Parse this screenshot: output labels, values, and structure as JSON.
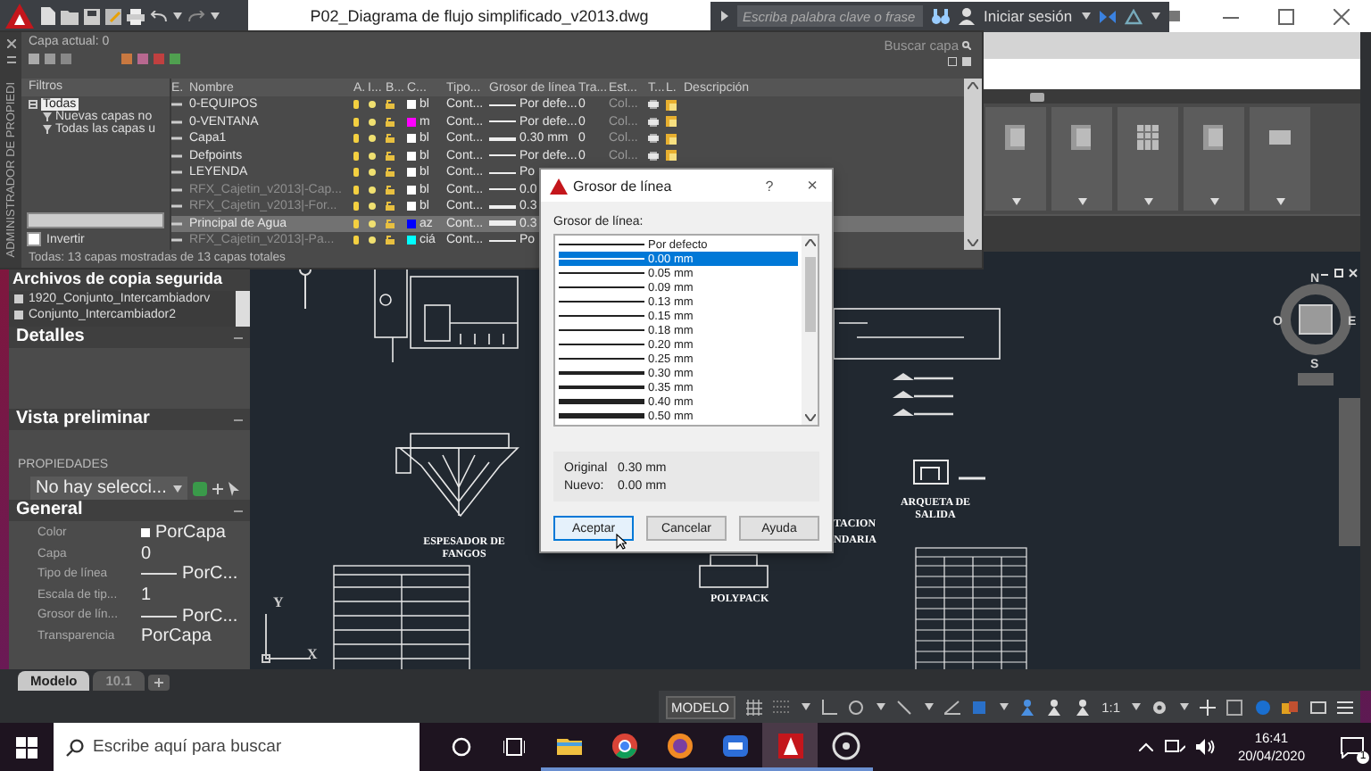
{
  "title_bar": {
    "title": "P02_Diagrama de flujo simplificado_v2013.dwg",
    "search": {
      "placeholder": "Escriba palabra clave o frase"
    },
    "sign_in": "Iniciar sesión"
  },
  "layer_manager": {
    "side_title": "ADMINISTRADOR DE PROPIEDI",
    "current_layer": "Capa actual: 0",
    "search": {
      "placeholder": "Buscar capa"
    },
    "filters_heading": "Filtros",
    "filters": [
      {
        "label": "Todas",
        "selected": true,
        "children": [
          {
            "label": "Nuevas capas no",
            "selected": false
          },
          {
            "label": "Todas las capas u",
            "selected": false
          }
        ]
      }
    ],
    "invert": {
      "label": "Invertir",
      "checked": false
    },
    "columns": [
      "E.",
      "Nombre",
      "A.",
      "I...",
      "B...",
      "C...",
      "Tipo...",
      "Grosor de línea",
      "Tra...",
      "Est...",
      "T...",
      "L.",
      "Descripción"
    ],
    "rows": [
      {
        "name": "0-EQUIPOS",
        "greyed": false,
        "selected": false,
        "color": "#ffffff",
        "color_label": "bl",
        "linetype": "Cont...",
        "kind": "thin",
        "lineweight": "Por defe...",
        "transparency": "0",
        "plot_style": "Col..."
      },
      {
        "name": "0-VENTANA",
        "greyed": false,
        "selected": false,
        "color": "#ff00ff",
        "color_label": "m",
        "linetype": "Cont...",
        "kind": "thin",
        "lineweight": "Por defe...",
        "transparency": "0",
        "plot_style": "Col..."
      },
      {
        "name": "Capa1",
        "greyed": false,
        "selected": false,
        "color": "#ffffff",
        "color_label": "bl",
        "linetype": "Cont...",
        "kind": "medium",
        "lineweight": "0.30 mm",
        "transparency": "0",
        "plot_style": "Col..."
      },
      {
        "name": "Defpoints",
        "greyed": false,
        "selected": false,
        "color": "#ffffff",
        "color_label": "bl",
        "linetype": "Cont...",
        "kind": "thin",
        "lineweight": "Por defe...",
        "transparency": "0",
        "plot_style": "Col..."
      },
      {
        "name": "LEYENDA",
        "greyed": false,
        "selected": false,
        "color": "#ffffff",
        "color_label": "bl",
        "linetype": "Cont...",
        "kind": "thin",
        "lineweight": "Po"
      },
      {
        "name": "RFX_Cajetin_v2013|-Cap...",
        "greyed": true,
        "selected": false,
        "color": "#ffffff",
        "color_label": "bl",
        "linetype": "Cont...",
        "kind": "thin",
        "lineweight": "0.0"
      },
      {
        "name": "RFX_Cajetin_v2013|-For...",
        "greyed": true,
        "selected": false,
        "color": "#ffffff",
        "color_label": "bl",
        "linetype": "Cont...",
        "kind": "medium",
        "lineweight": "0.3"
      },
      {
        "name": "Principal de Agua",
        "greyed": false,
        "selected": true,
        "color": "#0000ff",
        "color_label": "az",
        "linetype": "Cont...",
        "kind": "thick",
        "lineweight": "0.3"
      },
      {
        "name": "RFX_Cajetin_v2013|-Pa...",
        "greyed": true,
        "selected": false,
        "color": "#00ffff",
        "color_label": "ciá",
        "linetype": "Cont...",
        "kind": "thin",
        "lineweight": "Po"
      }
    ],
    "status": "Todas: 13 capas mostradas de 13 capas totales"
  },
  "palettes": {
    "backup": {
      "title": "Archivos de copia segurida",
      "items": [
        "1920_Conjunto_Intercambiadorv",
        "Conjunto_Intercambiador2"
      ]
    },
    "details": {
      "title": "Detalles"
    },
    "preview": {
      "title": "Vista preliminar"
    },
    "properties": {
      "heading": "PROPIEDADES",
      "selector": "No hay selecci...",
      "section": "General",
      "rows": [
        {
          "label": "Color",
          "value": "PorCapa",
          "kind": "swatch"
        },
        {
          "label": "Capa",
          "value": "0",
          "kind": "text"
        },
        {
          "label": "Tipo de línea",
          "value": "PorC...",
          "kind": "line"
        },
        {
          "label": "Escala de tip...",
          "value": "1",
          "kind": "text"
        },
        {
          "label": "Grosor de lín...",
          "value": "PorC...",
          "kind": "line"
        },
        {
          "label": "Transparencia",
          "value": "PorCapa",
          "kind": "text"
        }
      ]
    }
  },
  "canvas": {
    "labels": [
      {
        "text": "ESPESADOR DE FANGOS",
        "kind": "thickener"
      },
      {
        "text": "ARQUETA DE SALIDA",
        "kind": "outlet"
      },
      {
        "text": "POLYPACK",
        "kind": "polypack"
      },
      {
        "text": "TACION",
        "kind": "cut1"
      },
      {
        "text": "NDARIA",
        "kind": "cut2"
      }
    ],
    "ucs": {
      "x": "X",
      "y": "Y"
    },
    "viewcube": {
      "north": "N",
      "south": "S",
      "east": "E",
      "west": "O"
    }
  },
  "dialog": {
    "title": "Grosor de línea",
    "help": "?",
    "close": "×",
    "list_label": "Grosor de línea:",
    "items": [
      {
        "label": "Por defecto",
        "kind": "thin",
        "selected": false
      },
      {
        "label": "0.00 mm",
        "kind": "thin",
        "selected": true
      },
      {
        "label": "0.05 mm",
        "kind": "thin",
        "selected": false
      },
      {
        "label": "0.09 mm",
        "kind": "thin",
        "selected": false
      },
      {
        "label": "0.13 mm",
        "kind": "thin",
        "selected": false
      },
      {
        "label": "0.15 mm",
        "kind": "thin",
        "selected": false
      },
      {
        "label": "0.18 mm",
        "kind": "thin",
        "selected": false
      },
      {
        "label": "0.20 mm",
        "kind": "thin",
        "selected": false
      },
      {
        "label": "0.25 mm",
        "kind": "thin",
        "selected": false
      },
      {
        "label": "0.30 mm",
        "kind": "medium",
        "selected": false
      },
      {
        "label": "0.35 mm",
        "kind": "medium",
        "selected": false
      },
      {
        "label": "0.40 mm",
        "kind": "thick",
        "selected": false
      },
      {
        "label": "0.50 mm",
        "kind": "thick",
        "selected": false
      }
    ],
    "original": {
      "label": "Original",
      "value": "0.30 mm"
    },
    "new": {
      "label": "Nuevo:",
      "value": "0.00 mm"
    },
    "buttons": [
      {
        "label": "Aceptar",
        "kind": "default"
      },
      {
        "label": "Cancelar",
        "kind": "normal"
      },
      {
        "label": "Ayuda",
        "kind": "normal"
      }
    ]
  },
  "layout_tabs": [
    {
      "label": "Modelo",
      "selected": true
    },
    {
      "label": "10.1",
      "selected": false
    }
  ],
  "status_bar": {
    "model": "MODELO",
    "scale": "1:1"
  },
  "taskbar": {
    "search": {
      "placeholder": "Escribe aquí para buscar"
    },
    "apps": [
      {
        "kind": "folder",
        "active": false
      },
      {
        "kind": "browser",
        "active": false
      },
      {
        "kind": "shield",
        "active": false
      },
      {
        "kind": "video",
        "active": false
      },
      {
        "kind": "cad",
        "active": true
      },
      {
        "kind": "recorder",
        "active": false
      }
    ],
    "time": "16:41",
    "date": "20/04/2020",
    "notifications": "1"
  }
}
